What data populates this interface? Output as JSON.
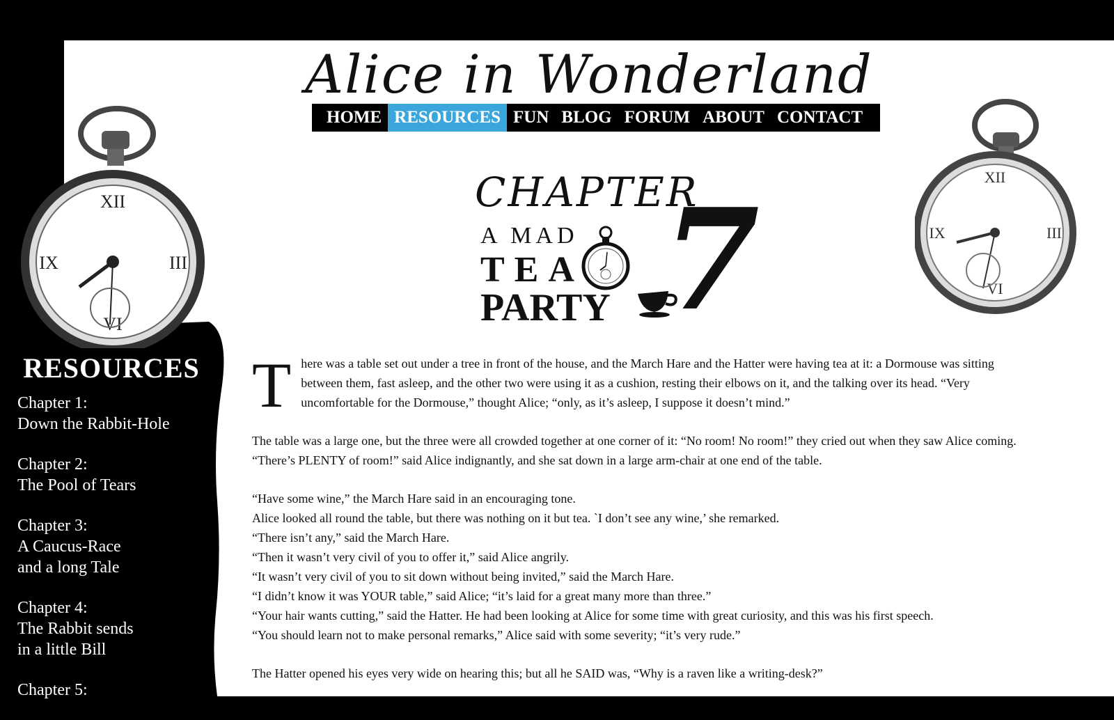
{
  "site": {
    "title": "Alice in Wonderland"
  },
  "nav": {
    "items": [
      "HOME",
      "RESOURCES",
      "FUN",
      "BLOG",
      "FORUM",
      "ABOUT",
      "CONTACT"
    ],
    "active_index": 1
  },
  "chapter_banner": {
    "word": "CHAPTER",
    "line1": "A MAD",
    "line2": "TEA",
    "line3": "PARTY",
    "number": "7"
  },
  "article": {
    "dropcap": "T",
    "paragraph1": "here was a table set out under a tree in front of the house, and the March Hare and the Hatter were having tea at it: a Dormouse was sitting between them, fast asleep, and the other two were using it as a cushion, resting their elbows on it, and the talking over its head. “Very uncomfortable for the Dormouse,” thought Alice; “only, as it’s asleep, I suppose it doesn’t mind.”",
    "paragraph2": "The table was a large one, but the three were all crowded together at one corner of it: “No room! No room!” they cried out when they saw Alice coming. “There’s PLENTY of room!” said Alice indignantly, and she sat down in a large arm-chair at one end of the table.",
    "lines": [
      "“Have some wine,” the March Hare said in an encouraging tone.",
      "Alice looked all round the table, but there was nothing on it but tea. `I don’t see any wine,’ she remarked.",
      "“There isn’t any,” said the March Hare.",
      "“Then it wasn’t very civil of you to offer it,” said Alice angrily.",
      "“It wasn’t very civil of you to sit down without being invited,” said the March Hare.",
      "“I didn’t know it was YOUR table,” said Alice; “it’s laid for a great many more than three.”",
      "“Your hair wants cutting,” said the Hatter. He had been looking at Alice for some time with great curiosity, and this was his first speech.",
      "“You should learn not to make personal remarks,” Alice said with some severity; “it’s very rude.”"
    ],
    "paragraph4": "The Hatter opened his eyes very wide on hearing this; but all he SAID was, “Why is a raven like a writing-desk?”"
  },
  "sidebar": {
    "heading": "RESOURCES",
    "items": [
      {
        "line1": "Chapter 1:",
        "line2": "Down the Rabbit-Hole"
      },
      {
        "line1": "Chapter 2:",
        "line2": "The Pool of Tears"
      },
      {
        "line1": "Chapter 3:",
        "line2": "A Caucus-Race",
        "line3": "and a long Tale"
      },
      {
        "line1": "Chapter 4:",
        "line2": "The Rabbit sends",
        "line3": "in a little Bill"
      },
      {
        "line1": "Chapter 5:"
      }
    ]
  }
}
